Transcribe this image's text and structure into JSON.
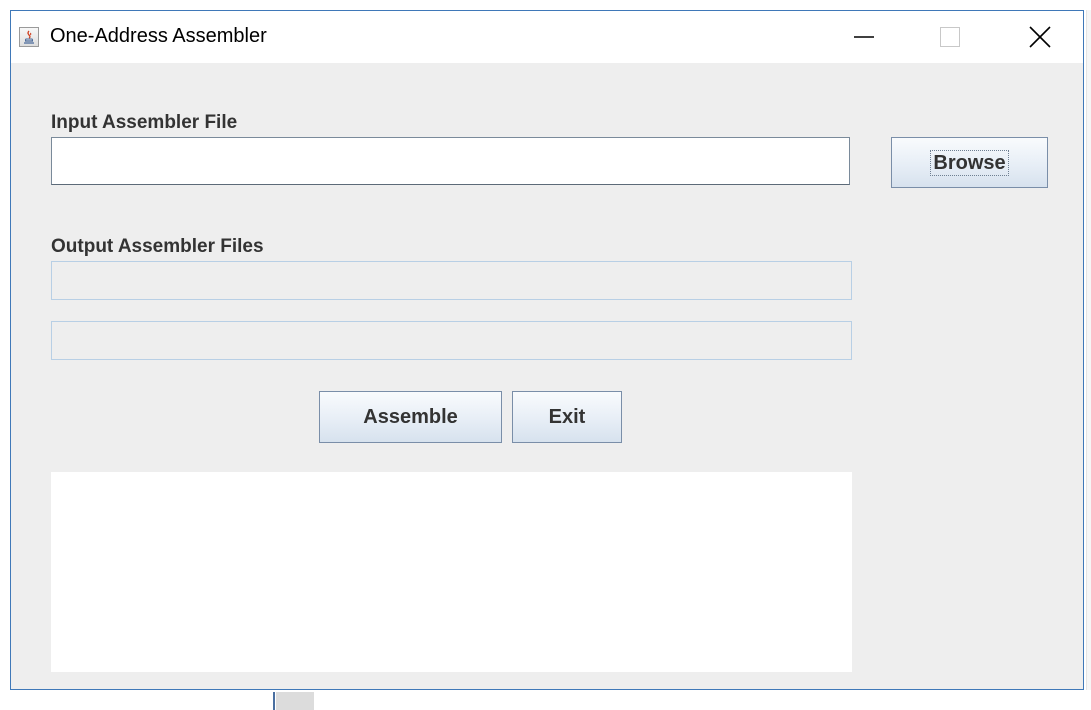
{
  "window": {
    "title": "One-Address Assembler",
    "icon": "java-coffee-icon"
  },
  "titlebar_controls": {
    "minimize_icon": "minimize-icon",
    "maximize_icon": "maximize-icon",
    "close_icon": "close-icon"
  },
  "form": {
    "input_label": "Input Assembler File",
    "input_value": "",
    "browse_label": "Browse",
    "output_label": "Output Assembler Files",
    "output_1_value": "",
    "output_2_value": "",
    "assemble_label": "Assemble",
    "exit_label": "Exit",
    "log_text": ""
  },
  "colors": {
    "window_border": "#3f78b8",
    "panel_background": "#eeeeee",
    "label_text": "#333333"
  }
}
